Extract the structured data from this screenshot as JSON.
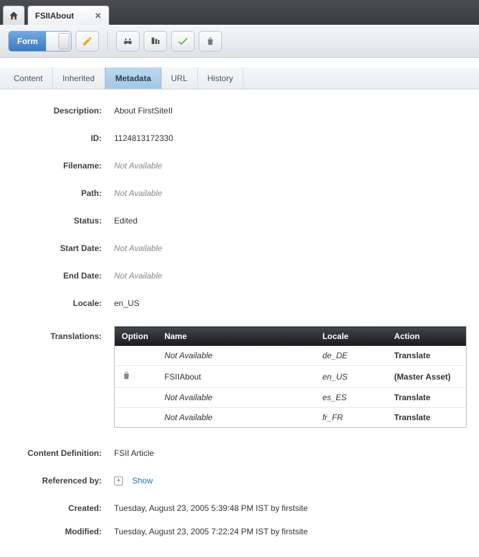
{
  "tab": {
    "title": "FSIIAbout"
  },
  "formToggle": {
    "label": "Form"
  },
  "subtabs": {
    "content": "Content",
    "inherited": "Inherited",
    "metadata": "Metadata",
    "url": "URL",
    "history": "History"
  },
  "labels": {
    "description": "Description:",
    "id": "ID:",
    "filename": "Filename:",
    "path": "Path:",
    "status": "Status:",
    "startDate": "Start Date:",
    "endDate": "End Date:",
    "locale": "Locale:",
    "translations": "Translations:",
    "contentDefinition": "Content Definition:",
    "referencedBy": "Referenced by:",
    "created": "Created:",
    "modified": "Modified:"
  },
  "values": {
    "description": "About FirstSiteII",
    "id": "1124813172330",
    "filename": "Not Available",
    "path": "Not Available",
    "status": "Edited",
    "startDate": "Not Available",
    "endDate": "Not Available",
    "locale": "en_US",
    "contentDefinition": "FSII Article",
    "created": "Tuesday, August 23, 2005 5:39:48 PM IST by firstsite",
    "modified": "Tuesday, August 23, 2005 7:22:24 PM IST by firstsite"
  },
  "transHeaders": {
    "option": "Option",
    "name": "Name",
    "locale": "Locale",
    "action": "Action"
  },
  "translations": [
    {
      "name": "Not Available",
      "locale": "de_DE",
      "action": "Translate",
      "na": true,
      "trash": false
    },
    {
      "name": "FSIIAbout",
      "locale": "en_US",
      "action": "(Master Asset)",
      "na": false,
      "trash": true
    },
    {
      "name": "Not Available",
      "locale": "es_ES",
      "action": "Translate",
      "na": true,
      "trash": false
    },
    {
      "name": "Not Available",
      "locale": "fr_FR",
      "action": "Translate",
      "na": true,
      "trash": false
    }
  ],
  "referencedBy": {
    "show": "Show"
  }
}
